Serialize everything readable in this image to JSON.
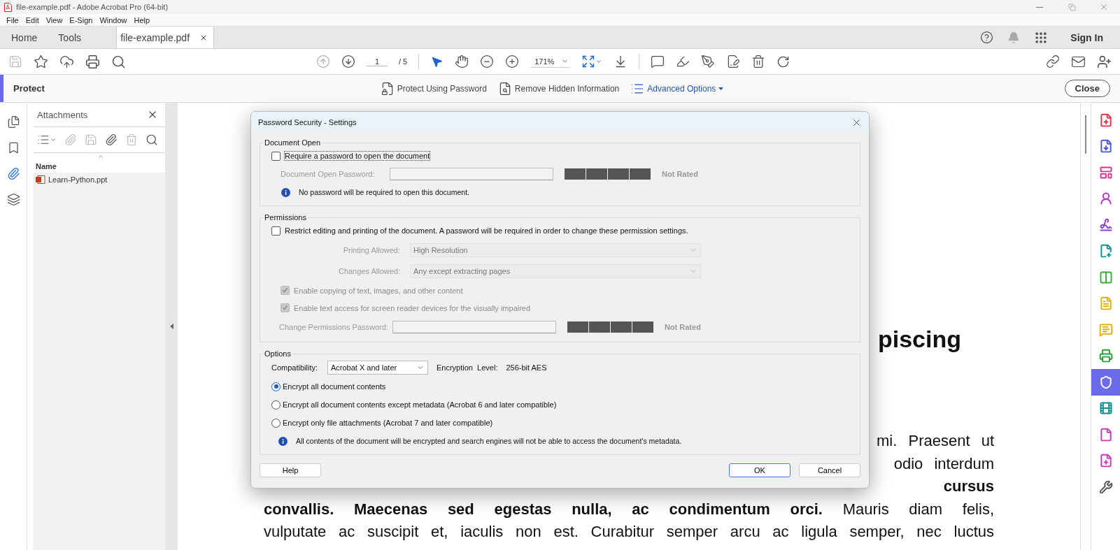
{
  "window": {
    "title": "file-example.pdf - Adobe Acrobat Pro (64-bit)"
  },
  "menu": [
    "File",
    "Edit",
    "View",
    "E-Sign",
    "Window",
    "Help"
  ],
  "tabs": [
    {
      "label": "Home",
      "selected": false
    },
    {
      "label": "Tools",
      "selected": false
    },
    {
      "label": "file-example.pdf",
      "selected": true
    }
  ],
  "account": {
    "sign_in": "Sign In"
  },
  "toolbar": {
    "page": "1",
    "page_total": "/ 5",
    "zoom": "171%"
  },
  "protect_bar": {
    "title": "Protect",
    "actions": [
      {
        "label": "Protect Using Password",
        "kind": "plain"
      },
      {
        "label": "Remove Hidden Information",
        "kind": "plain"
      },
      {
        "label": "Advanced Options",
        "kind": "dropdown"
      }
    ],
    "close": "Close"
  },
  "left_rail": [
    {
      "selected": false
    },
    {
      "selected": false
    },
    {
      "selected": true
    },
    {
      "selected": false
    }
  ],
  "attachments": {
    "title": "Attachments",
    "column": "Name",
    "files": [
      {
        "name": "Learn-Python.ppt"
      }
    ]
  },
  "document": {
    "heading": "piscing",
    "lines": [
      {
        "kind": "tail",
        "bold": false,
        "text": "mi. Praesent ut"
      },
      {
        "kind": "tail",
        "bold": false,
        "text": "odio interdum"
      },
      {
        "kind": "tail",
        "bold": true,
        "text": "cursus"
      },
      {
        "kind": "full",
        "bold": false,
        "text": "**convallis. Maecenas sed egestas nulla, ac condimentum orci.** Mauris diam felis,"
      },
      {
        "kind": "full",
        "bold": false,
        "text": "vulputate ac suscipit et, iaculis non est. Curabitur semper arcu ac ligula semper, nec luctus"
      }
    ]
  },
  "right_rail": [
    {
      "color": "#e0344a",
      "selected": false
    },
    {
      "color": "#4b57d6",
      "selected": false
    },
    {
      "color": "#e0348c",
      "selected": false
    },
    {
      "color": "#b030c8",
      "selected": false
    },
    {
      "color": "#8a3fd8",
      "selected": false
    },
    {
      "color": "#138f8f",
      "selected": false
    },
    {
      "color": "#3aad3a",
      "selected": false
    },
    {
      "color": "#e0b000",
      "selected": false
    },
    {
      "color": "#e0b000",
      "selected": false
    },
    {
      "color": "#2e9e3a",
      "selected": false
    },
    {
      "color": "#ffffff",
      "selected": true
    },
    {
      "color": "#138f8f",
      "selected": false
    },
    {
      "color": "#c83cb8",
      "selected": false
    },
    {
      "color": "#c83cb8",
      "selected": false
    },
    {
      "color": "#555555",
      "selected": false
    }
  ],
  "dialog": {
    "title": "Password Security - Settings",
    "document_open": {
      "legend": "Document Open",
      "require": {
        "label": "Require a password to open the document",
        "checked": false
      },
      "password": {
        "label": "Document Open Password:",
        "disabled": true
      },
      "rating": "Not Rated",
      "info": "No password will be required to open this document."
    },
    "permissions": {
      "legend": "Permissions",
      "restrict": {
        "label": "Restrict editing and printing of the document. A password will be required in order to change these permission settings.",
        "checked": false
      },
      "selects": [
        {
          "label": "Printing Allowed:",
          "value": "High Resolution",
          "disabled": true
        },
        {
          "label": "Changes Allowed:",
          "value": "Any except extracting pages",
          "disabled": true
        }
      ],
      "checks": [
        {
          "label": "Enable copying of text, images, and other content",
          "checked": true,
          "disabled": true
        },
        {
          "label": "Enable text access for screen reader devices for the visually impaired",
          "checked": true,
          "disabled": true
        }
      ],
      "password": {
        "label": "Change Permissions Password:",
        "disabled": true
      },
      "rating": "Not Rated"
    },
    "options": {
      "legend": "Options",
      "compatibility": {
        "label": "Compatibility:",
        "value": "Acrobat X and later"
      },
      "encryption": {
        "label": "Encryption  Level:",
        "value": "256-bit AES"
      },
      "radios": [
        {
          "label": "Encrypt all document contents",
          "selected": true
        },
        {
          "label": "Encrypt all document contents except metadata (Acrobat 6 and later compatible)",
          "selected": false
        },
        {
          "label": "Encrypt only file attachments (Acrobat 7 and later compatible)",
          "selected": false
        }
      ],
      "info": "All contents of the document will be encrypted and search engines will not be able to access the document's metadata."
    },
    "buttons": [
      {
        "label": "Help",
        "default": false
      },
      {
        "label": "OK",
        "default": true
      },
      {
        "label": "Cancel",
        "default": false
      }
    ]
  }
}
